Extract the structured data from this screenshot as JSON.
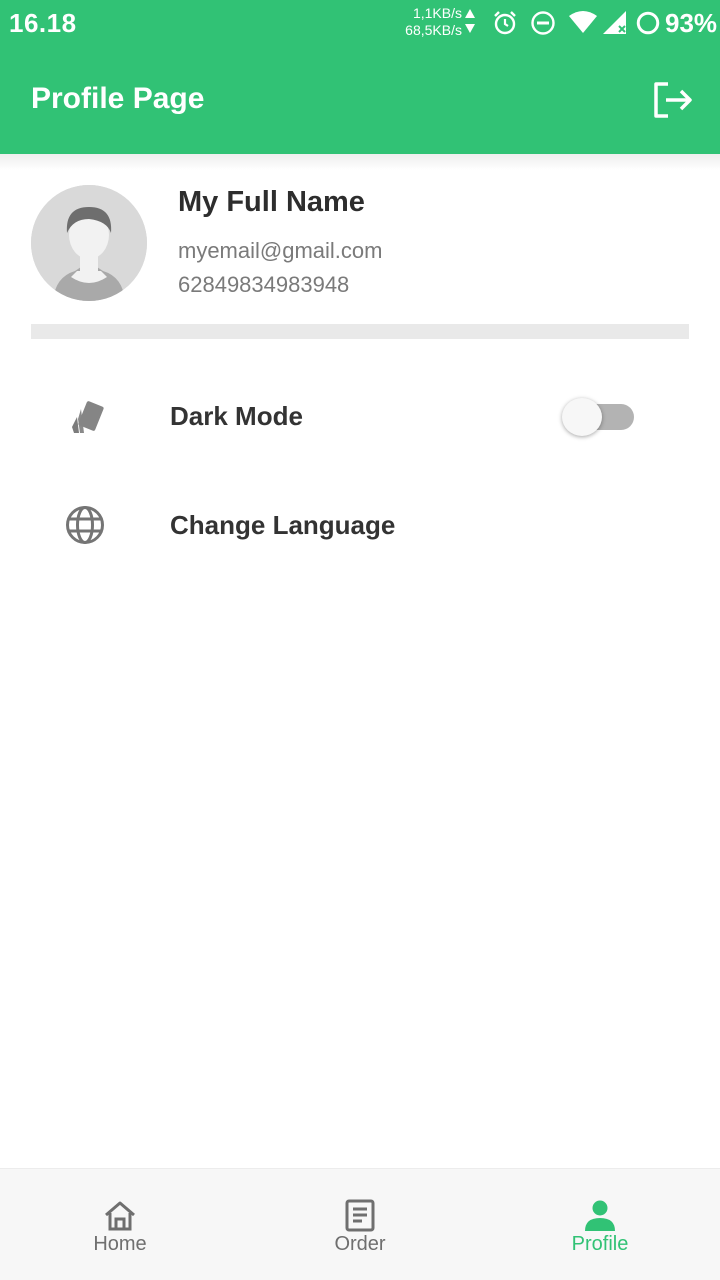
{
  "status_bar": {
    "time": "16.18",
    "upload_speed": "1,1KB/s",
    "download_speed": "68,5KB/s",
    "icons": [
      "alarm-icon",
      "do-not-disturb-icon",
      "wifi-icon",
      "signal-icon",
      "battery-icon"
    ],
    "battery": "93%"
  },
  "app_bar": {
    "title": "Profile Page",
    "action_icon": "logout-icon"
  },
  "profile": {
    "name": "My Full Name",
    "email": "myemail@gmail.com",
    "phone": "62849834983948"
  },
  "settings": [
    {
      "icon": "palette-icon",
      "label": "Dark Mode",
      "toggle_on": false
    },
    {
      "icon": "globe-icon",
      "label": "Change Language"
    }
  ],
  "bottom_nav": {
    "items": [
      {
        "icon": "home-icon",
        "label": "Home",
        "active": false
      },
      {
        "icon": "order-icon",
        "label": "Order",
        "active": false
      },
      {
        "icon": "person-icon",
        "label": "Profile",
        "active": true
      }
    ]
  },
  "colors": {
    "primary": "#31c275",
    "toggle_track_off": "#b3b3b3",
    "nav_inactive": "#6f6f6f"
  }
}
